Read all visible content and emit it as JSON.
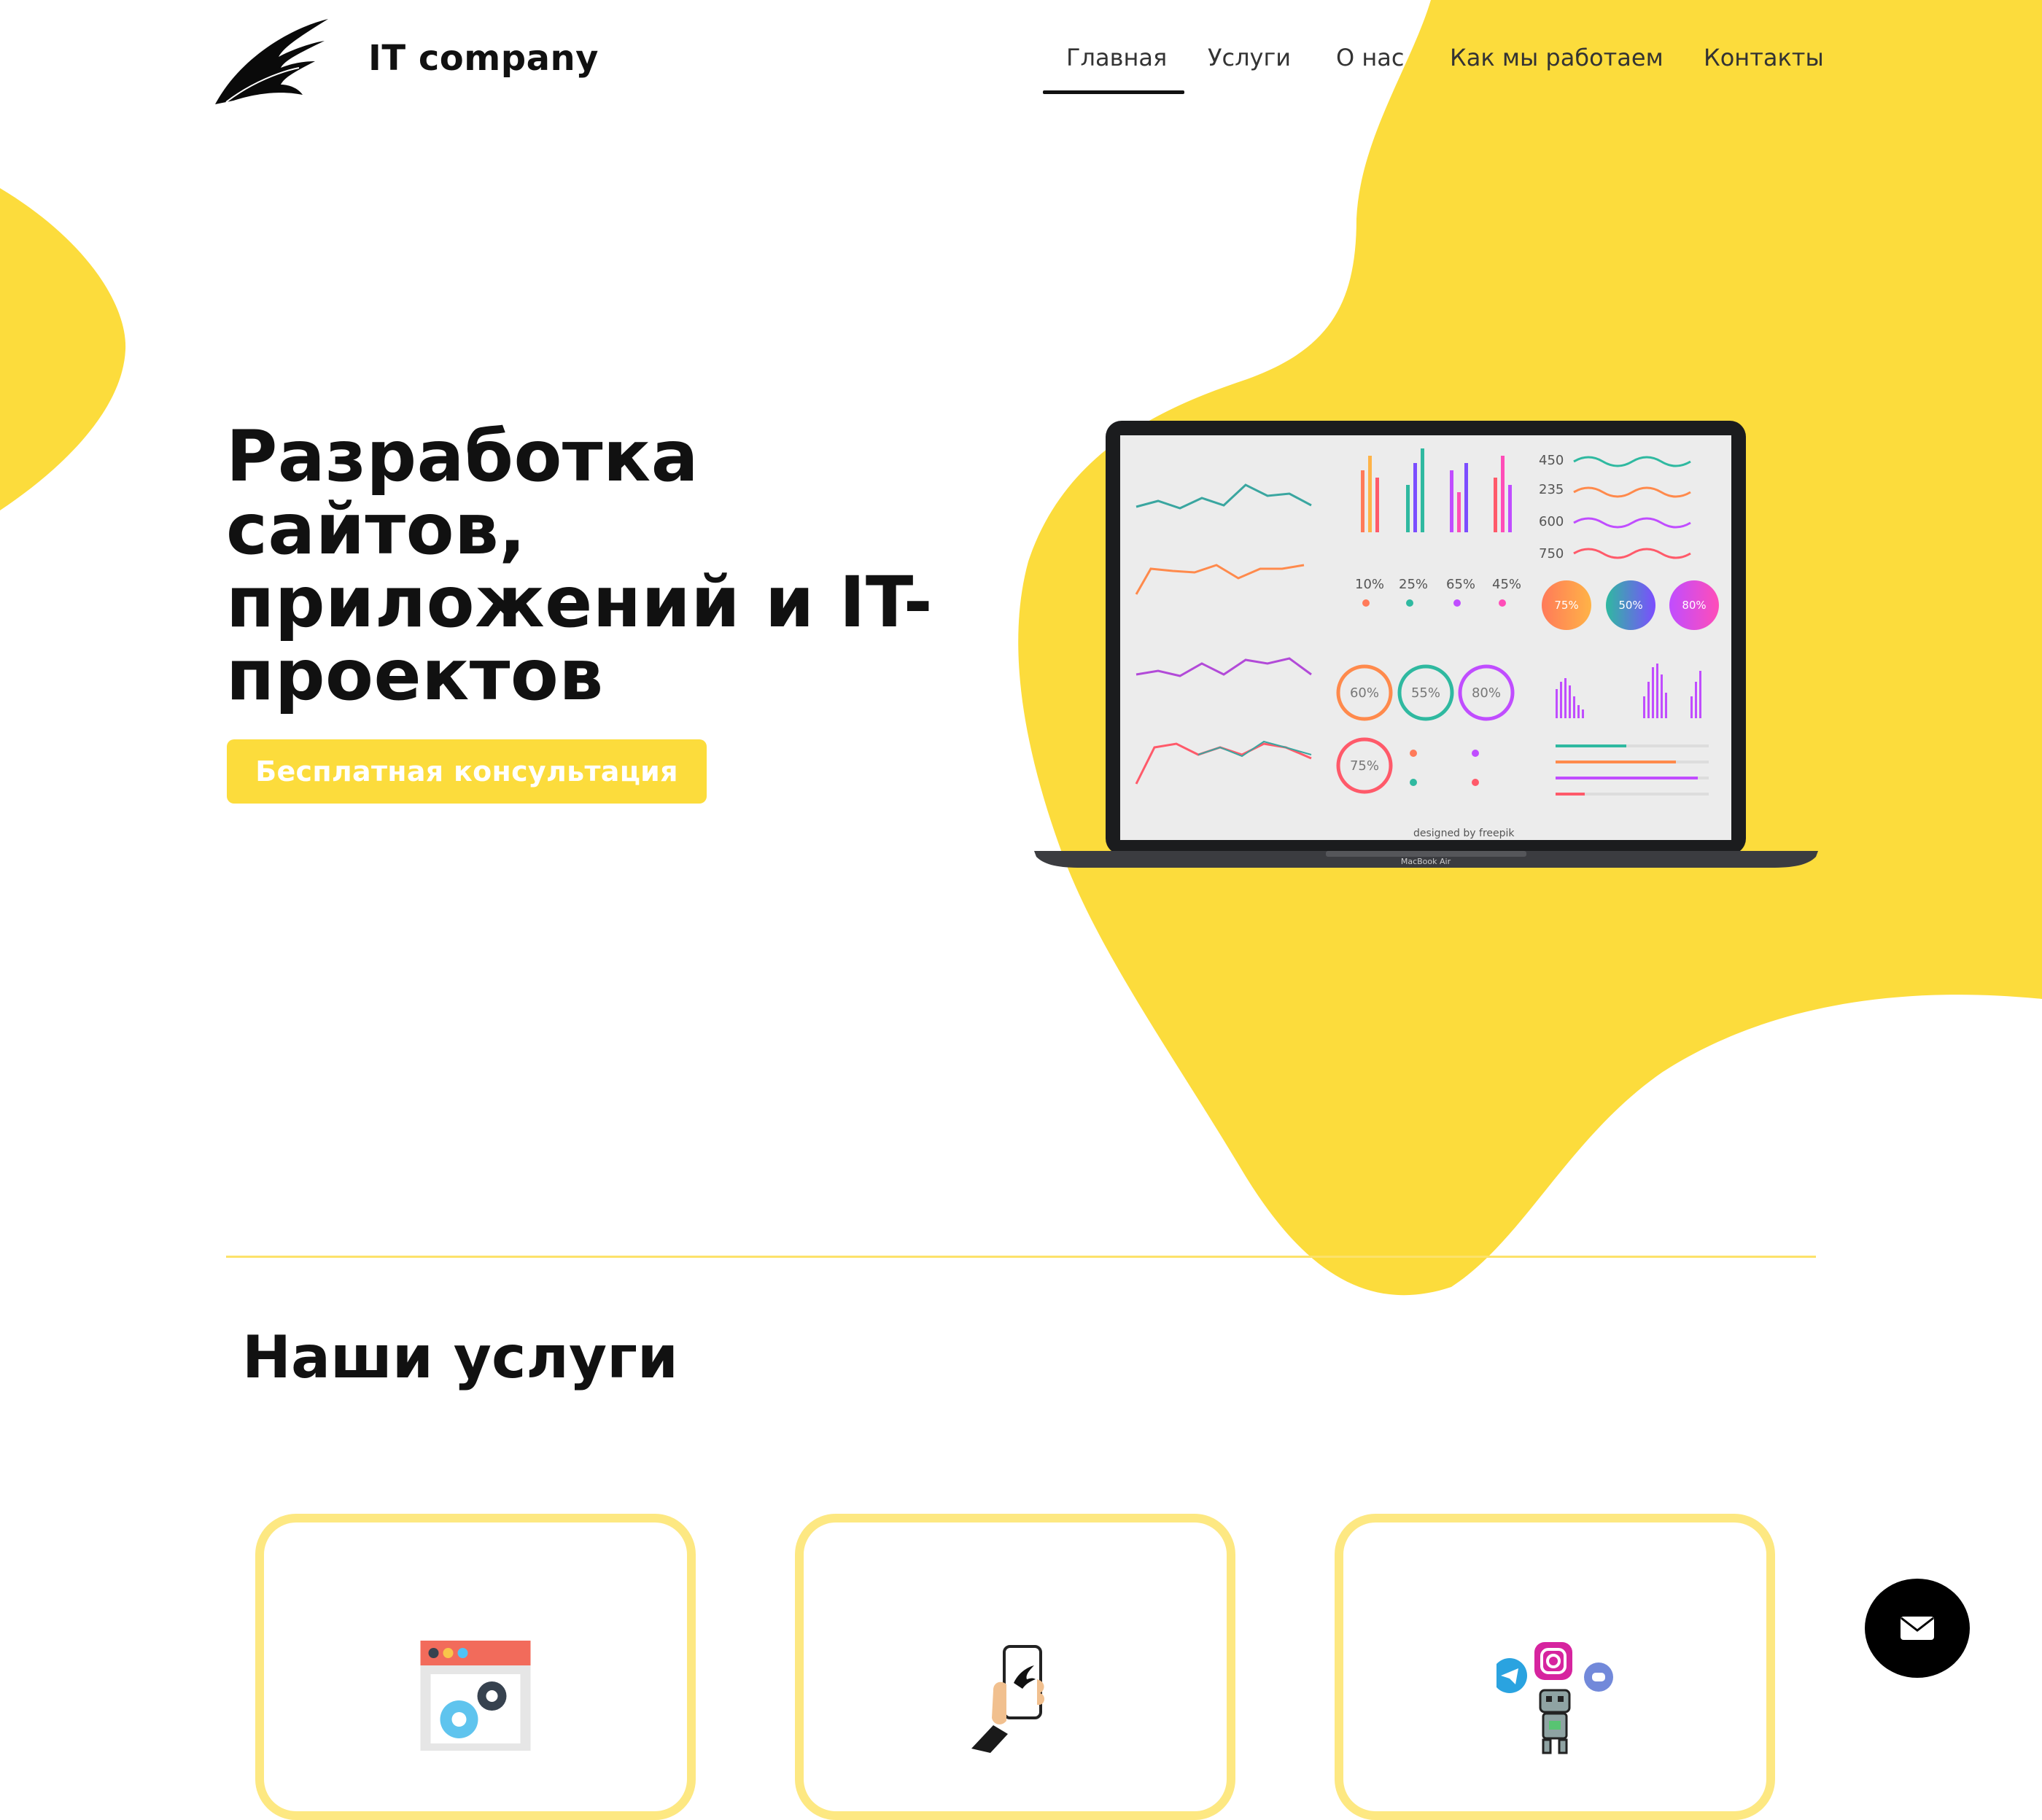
{
  "header": {
    "brand": "IT company",
    "logo_icon": "feather-wing-logo",
    "nav": [
      {
        "label": "Главная",
        "active": true
      },
      {
        "label": "Услуги"
      },
      {
        "label": "О нас"
      },
      {
        "label": "Как мы работаем"
      },
      {
        "label": "Контакты"
      }
    ]
  },
  "hero": {
    "title_lines": [
      "Разработка сайтов,",
      "приложений и IT-",
      "проектов"
    ],
    "cta_label": "Бесплатная консультация",
    "laptop": {
      "label": "MacBook Air",
      "credit": "designed by freepik",
      "stats_left": [
        "450",
        "235",
        "600",
        "750"
      ],
      "percents_row": [
        "10%",
        "25%",
        "65%",
        "45%"
      ],
      "ring_percents": [
        "75%",
        "50%",
        "80%"
      ],
      "circle_percents": [
        "60%",
        "55%",
        "80%",
        "75%"
      ]
    }
  },
  "services": {
    "title": "Наши услуги",
    "cards": [
      {
        "icon": "web-settings-icon"
      },
      {
        "icon": "mobile-app-icon"
      },
      {
        "icon": "chatbot-social-icon"
      }
    ]
  },
  "fab": {
    "icon": "envelope-icon"
  },
  "colors": {
    "accent": "#fcdc3c",
    "accent_light": "#fde882",
    "text": "#111111"
  }
}
